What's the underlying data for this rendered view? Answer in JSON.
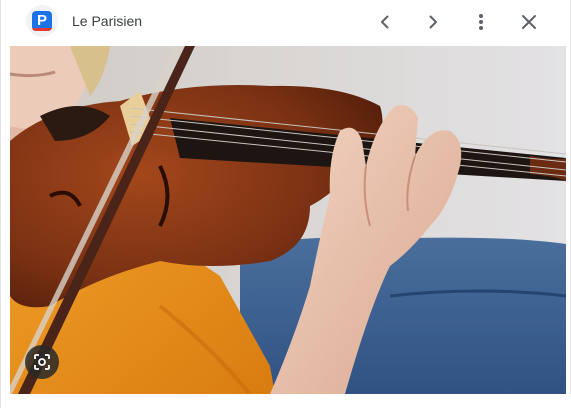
{
  "header": {
    "favicon_letter": "P",
    "site_name": "Le Parisien"
  },
  "icons": {
    "prev": "chevron-left-icon",
    "next": "chevron-right-icon",
    "more": "more-vert-icon",
    "close": "close-icon",
    "lens": "lens-search-icon"
  },
  "colors": {
    "favicon_blue": "#1a73e8",
    "favicon_red": "#e53935",
    "icon_gray": "#5f6368",
    "sweater_orange": "#e8901a",
    "sofa_blue": "#3a5e8c",
    "violin_brown": "#6b2a12"
  }
}
